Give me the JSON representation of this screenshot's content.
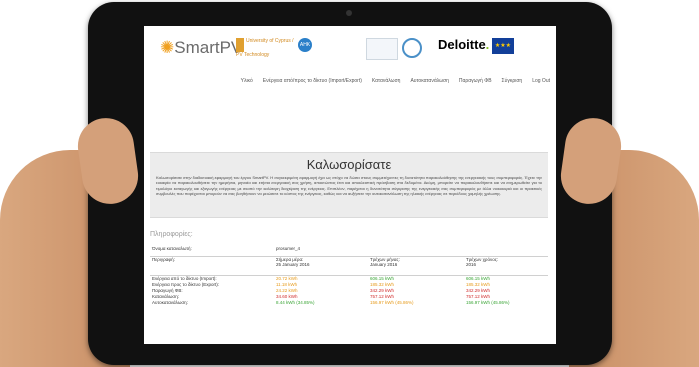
{
  "logos": {
    "smartpv": "SmartPV",
    "ucy": "University of Cyprus / PV Technology",
    "aha": "AHK",
    "deloitte": "Deloitte"
  },
  "nav": {
    "items": [
      "Υλικό",
      "Ενέργεια από/προς το δίκτυο (Import/Export)",
      "Κατανάλωση",
      "Αυτοκατανάλωση",
      "Παραγωγή ΦΒ",
      "Σύγκριση",
      "Log Out"
    ]
  },
  "welcome": {
    "title": "Καλωσορίσατε",
    "text": "Καλωσορίσατε στην διαδικτυακή εφαρμογή του έργου SmartPV. Η συγκεκριμένη εφαρμογή έχει ως στόχο να δώσει στους συμμετέχοντες τη δυνατότητα παρακολούθησης της ενεργειακής τους συμπεριφοράς. Έχετε την ευκαιρία να παρακολουθήσετε την ημερήσια, μηνιαία και ετήσια ενεργειακή σας χρήση, αποκτώντας έτσι και αποκλειστική πρόσβαση στα δεδομένα. Ακόμη, μπορείτε να παρακολουθήσετε και να ενημερωθείτε για το τιμολόγιο εισαγωγής και εξαγωγής ενέργειας με σκοπό την καλύτερη διαχείριση της ενέργειας. Επιπλέον, παρέχεται η δυνατότητα σύγκρισης της ενεργειακής σας συμπεριφοράς με άλλα νοικοκυριά και οι πρακτικές συμβουλές που παρέχονται μπορούν να σας βοηθήσουν να μειώσετε το κόστος της ενέργειας, καθώς και να αυξήσετε την αυτοκατανάλωση της ηλιακής ενέργειας σε περιόδους χαμηλής χρέωσης."
  },
  "info": {
    "title": "Πληροφορίες:",
    "user_label": "Όνομα καταναλωτή:",
    "user_value": "prosumer_4",
    "period_label": "Περιγραφή:",
    "col_day": "Σήμερα μέρα:\n25 January 2016",
    "col_month": "Τρέχων μήνας:\nJanuary 2016",
    "col_year": "Τρέχων χρόνος:\n2016",
    "rows": [
      {
        "label": "Ενέργεια από το δίκτυο (Import):",
        "day": "20.72 kWh",
        "month": "606.15 kWh",
        "year": "606.15 kWh"
      },
      {
        "label": "Ενέργεια προς το δίκτυο (Export):",
        "day": "11.18 kWh",
        "month": "185.32 kWh",
        "year": "185.32 kWh"
      },
      {
        "label": "Παραγωγή ΦΒ:",
        "day": "24.22 kWh",
        "month": "342.29 kWh",
        "year": "342.29 kWh"
      },
      {
        "label": "Κατανάλωση:",
        "day": "34.60 kWh",
        "month": "757.12 kWh",
        "year": "757.12 kWh"
      },
      {
        "label": "Αυτοκατανάλωση:",
        "day": "8.44 kWh (34.85%)",
        "month": "156.97 kWh (45.86%)",
        "year": "156.97 kWh (45.86%)"
      }
    ]
  },
  "colors": {
    "day": [
      "#e69a1a",
      "#e69a1a",
      "#e69a1a",
      "#d02c2c",
      "#3aa536"
    ],
    "month": [
      "#3aa536",
      "#e69a1a",
      "#d02c2c",
      "#d02c2c",
      "#e69a1a"
    ],
    "year": [
      "#3aa536",
      "#e69a1a",
      "#d02c2c",
      "#d02c2c",
      "#3aa536"
    ]
  }
}
